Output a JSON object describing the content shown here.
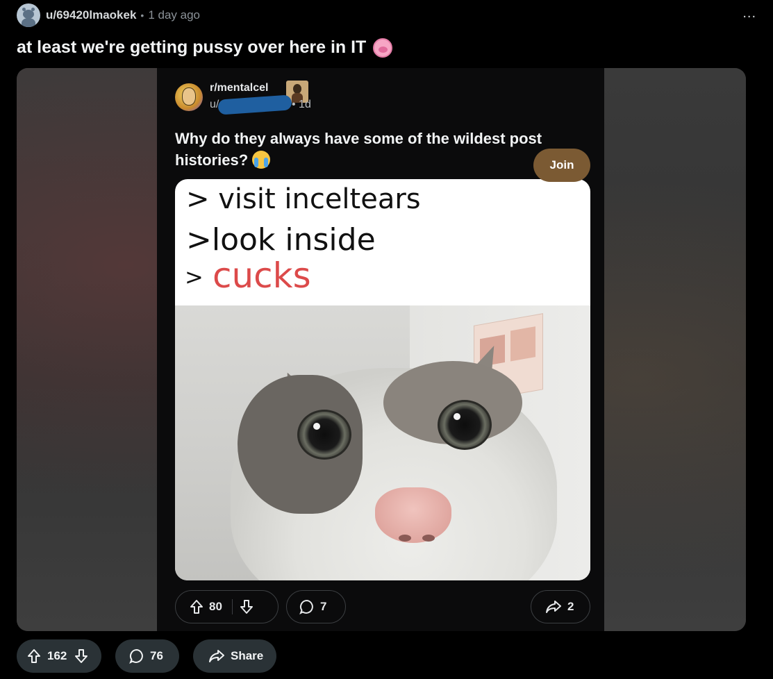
{
  "post": {
    "username": "u/69420lmaokek",
    "separator": "•",
    "time": "1 day ago",
    "more": "...",
    "title": "at least we're getting pussy over here in IT"
  },
  "embedded": {
    "subreddit": "r/mentalcel",
    "user_prefix": "u/",
    "time": "• 1d",
    "join_label": "Join",
    "title": "Why do they always have some of the wildest post histories?",
    "meme": {
      "line1": "> visit inceltears",
      "line2": ">look inside",
      "line3_prefix": ">",
      "line3": "cucks"
    },
    "upvotes": "80",
    "comments": "7",
    "shares": "2"
  },
  "actions": {
    "upvotes": "162",
    "comments": "76",
    "share_label": "Share"
  },
  "colors": {
    "background": "#000000",
    "join_button": "#7b5a33",
    "action_pill": "#2a3236",
    "meme_red": "#dc4a4a"
  }
}
